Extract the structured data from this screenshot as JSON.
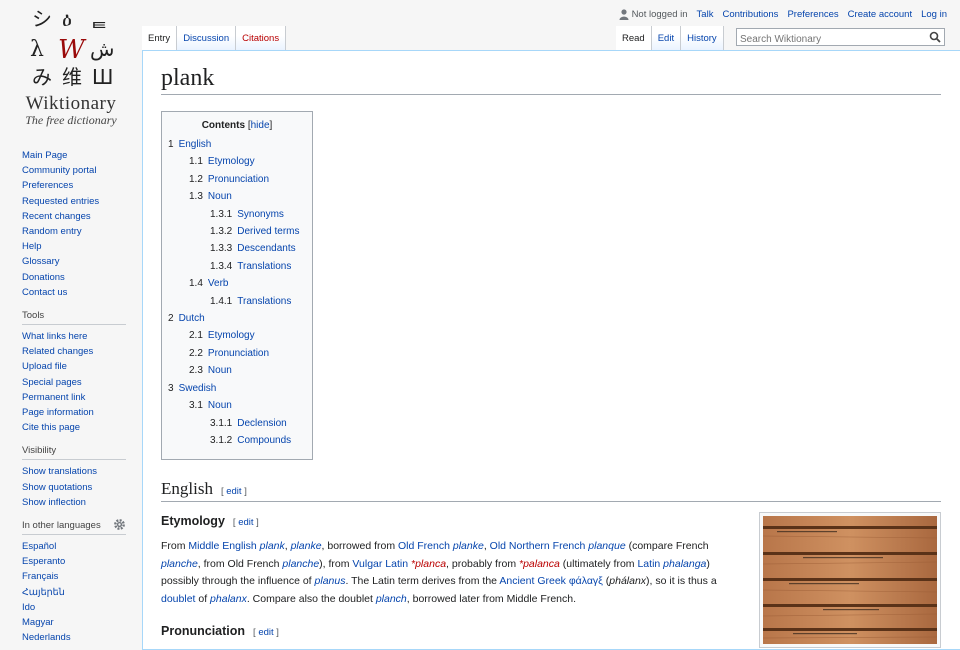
{
  "logo": {
    "name": "Wiktionary",
    "tagline": "The free dictionary"
  },
  "nav": [
    "Main Page",
    "Community portal",
    "Preferences",
    "Requested entries",
    "Recent changes",
    "Random entry",
    "Help",
    "Glossary",
    "Donations",
    "Contact us"
  ],
  "tools": {
    "heading": "Tools",
    "items": [
      "What links here",
      "Related changes",
      "Upload file",
      "Special pages",
      "Permanent link",
      "Page information",
      "Cite this page"
    ]
  },
  "visibility": {
    "heading": "Visibility",
    "items": [
      "Show translations",
      "Show quotations",
      "Show inflection"
    ]
  },
  "languages": {
    "heading": "In other languages",
    "items": [
      "Español",
      "Esperanto",
      "Français",
      "Հայերեն",
      "Ido",
      "Magyar",
      "Nederlands"
    ]
  },
  "personal": {
    "not_logged_in": "Not logged in",
    "talk": "Talk",
    "contributions": "Contributions",
    "preferences": "Preferences",
    "create_account": "Create account",
    "login": "Log in"
  },
  "tabs": {
    "entry": "Entry",
    "discussion": "Discussion",
    "citations": "Citations",
    "read": "Read",
    "edit": "Edit",
    "history": "History"
  },
  "search": {
    "placeholder": "Search Wiktionary"
  },
  "page": {
    "title": "plank"
  },
  "toc": {
    "title": "Contents",
    "hide": "hide",
    "items": [
      {
        "num": "1",
        "text": "English",
        "level": 1
      },
      {
        "num": "1.1",
        "text": "Etymology",
        "level": 2
      },
      {
        "num": "1.2",
        "text": "Pronunciation",
        "level": 2
      },
      {
        "num": "1.3",
        "text": "Noun",
        "level": 2
      },
      {
        "num": "1.3.1",
        "text": "Synonyms",
        "level": 3
      },
      {
        "num": "1.3.2",
        "text": "Derived terms",
        "level": 3
      },
      {
        "num": "1.3.3",
        "text": "Descendants",
        "level": 3
      },
      {
        "num": "1.3.4",
        "text": "Translations",
        "level": 3
      },
      {
        "num": "1.4",
        "text": "Verb",
        "level": 2
      },
      {
        "num": "1.4.1",
        "text": "Translations",
        "level": 3
      },
      {
        "num": "2",
        "text": "Dutch",
        "level": 1
      },
      {
        "num": "2.1",
        "text": "Etymology",
        "level": 2
      },
      {
        "num": "2.2",
        "text": "Pronunciation",
        "level": 2
      },
      {
        "num": "2.3",
        "text": "Noun",
        "level": 2
      },
      {
        "num": "3",
        "text": "Swedish",
        "level": 1
      },
      {
        "num": "3.1",
        "text": "Noun",
        "level": 2
      },
      {
        "num": "3.1.1",
        "text": "Declension",
        "level": 3
      },
      {
        "num": "3.1.2",
        "text": "Compounds",
        "level": 3
      }
    ]
  },
  "sections": {
    "english": "English",
    "etymology": "Etymology",
    "pronunciation": "Pronunciation",
    "edit": "edit"
  },
  "etymology": {
    "s1": "From ",
    "l1": "Middle English",
    "s2": " ",
    "l2": "plank",
    "s3": ", ",
    "l3": "planke",
    "s4": ", borrowed from ",
    "l4": "Old French",
    "s5": " ",
    "l5": "planke",
    "s6": ", ",
    "l6": "Old Northern French",
    "s7": " ",
    "l7": "planque",
    "s8": " (compare French ",
    "l8": "planche",
    "s9": ", from Old French ",
    "l9": "planche",
    "s10": "), from ",
    "l10": "Vulgar Latin",
    "s11": " ",
    "r1": "*planca",
    "s12": ", probably from ",
    "r2": "*palanca",
    "s13": " (ultimately from ",
    "l11": "Latin",
    "s14": " ",
    "l12": "phalanga",
    "s15": ") possibly through the influence of ",
    "l13": "planus",
    "s16": ". The Latin term derives from the ",
    "l14": "Ancient Greek",
    "s17": " ",
    "l15": "φάλαγξ",
    "s18": " (",
    "t1": "phálanx",
    "s19": "), so it is thus a ",
    "l16": "doublet",
    "s20": " of ",
    "l17": "phalanx",
    "s21": ". Compare also the doublet ",
    "l18": "planch",
    "s22": ", borrowed later from Middle French."
  }
}
